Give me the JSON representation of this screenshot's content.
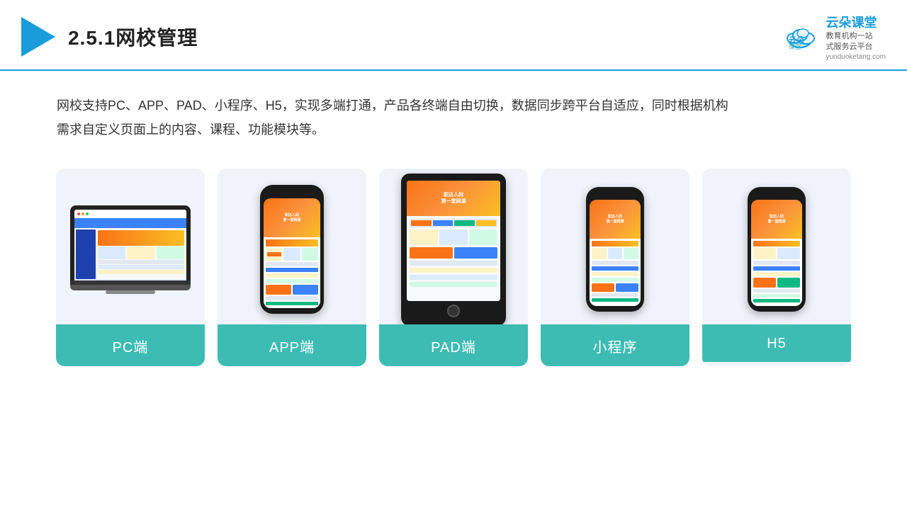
{
  "header": {
    "title": "2.5.1网校管理",
    "brand_name": "云朵课堂",
    "brand_sub_line1": "教育机构一站",
    "brand_sub_line2": "式服务云平台",
    "brand_url": "yunduoketang.com"
  },
  "description": {
    "text1": "网校支持PC、APP、PAD、小程序、H5，实现多端打通，产品各终端自由切换，数据同步跨平台自适应，同时根据机构",
    "text2": "需求自定义页面上的内容、课程、功能模块等。"
  },
  "cards": [
    {
      "id": "pc",
      "label": "PC端"
    },
    {
      "id": "app",
      "label": "APP端"
    },
    {
      "id": "pad",
      "label": "PAD端"
    },
    {
      "id": "miniapp",
      "label": "小程序"
    },
    {
      "id": "h5",
      "label": "H5"
    }
  ]
}
